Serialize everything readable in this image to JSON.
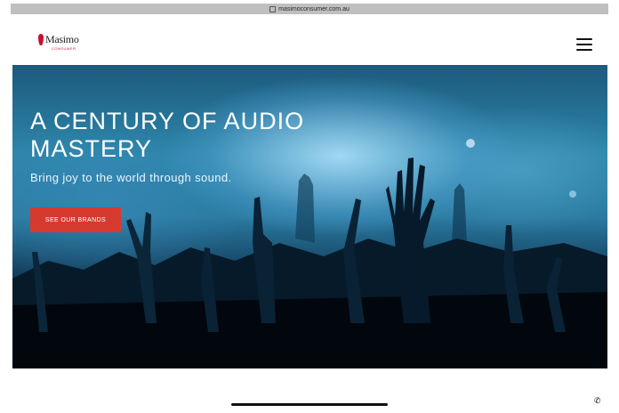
{
  "browser": {
    "url": "masimoconsumer.com.au"
  },
  "header": {
    "logo": {
      "word": "Masimo",
      "sub": "CONSUMER",
      "icon": "masimo-logo-icon"
    },
    "menu_icon": "hamburger-icon"
  },
  "hero": {
    "title": "A CENTURY OF AUDIO MASTERY",
    "subtitle": "Bring joy to the world through sound.",
    "cta_label": "SEE OUR BRANDS"
  },
  "colors": {
    "brand_red": "#c8102e",
    "cta_background": "#d63a2f",
    "hero_blue": "#2d86aa"
  },
  "footer": {
    "call_icon": "phone-icon"
  }
}
